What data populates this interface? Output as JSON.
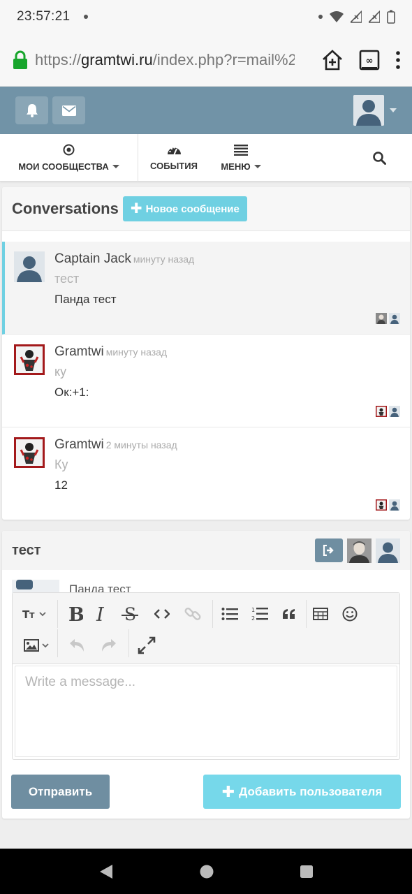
{
  "status_bar": {
    "time": "23:57:21"
  },
  "browser": {
    "url_prefix": "https://",
    "url_domain": "gramtwi.ru",
    "url_rest": "/index.php?r=mail%2"
  },
  "nav": {
    "communities": "МОИ СООБЩЕСТВА",
    "events": "СОБЫТИЯ",
    "menu": "МЕНЮ"
  },
  "conversations": {
    "title": "Conversations",
    "new_button": "Новое сообщение",
    "items": [
      {
        "name": "Captain Jack",
        "time": "минуту назад",
        "subject": "тест",
        "message": "Панда тест"
      },
      {
        "name": "Gramtwi",
        "time": "минуту назад",
        "subject": "ку",
        "message": "Ок:+1:"
      },
      {
        "name": "Gramtwi",
        "time": "2 минуты назад",
        "subject": "Ку",
        "message": "12"
      }
    ]
  },
  "chat": {
    "title": "тест",
    "preview_message": "Панда тест",
    "editor_placeholder": "Write a message...",
    "send_button": "Отправить",
    "add_user_button": "Добавить пользователя"
  },
  "colors": {
    "header": "#7193a7",
    "accent": "#6fd0e2",
    "send": "#6f8ea1"
  }
}
